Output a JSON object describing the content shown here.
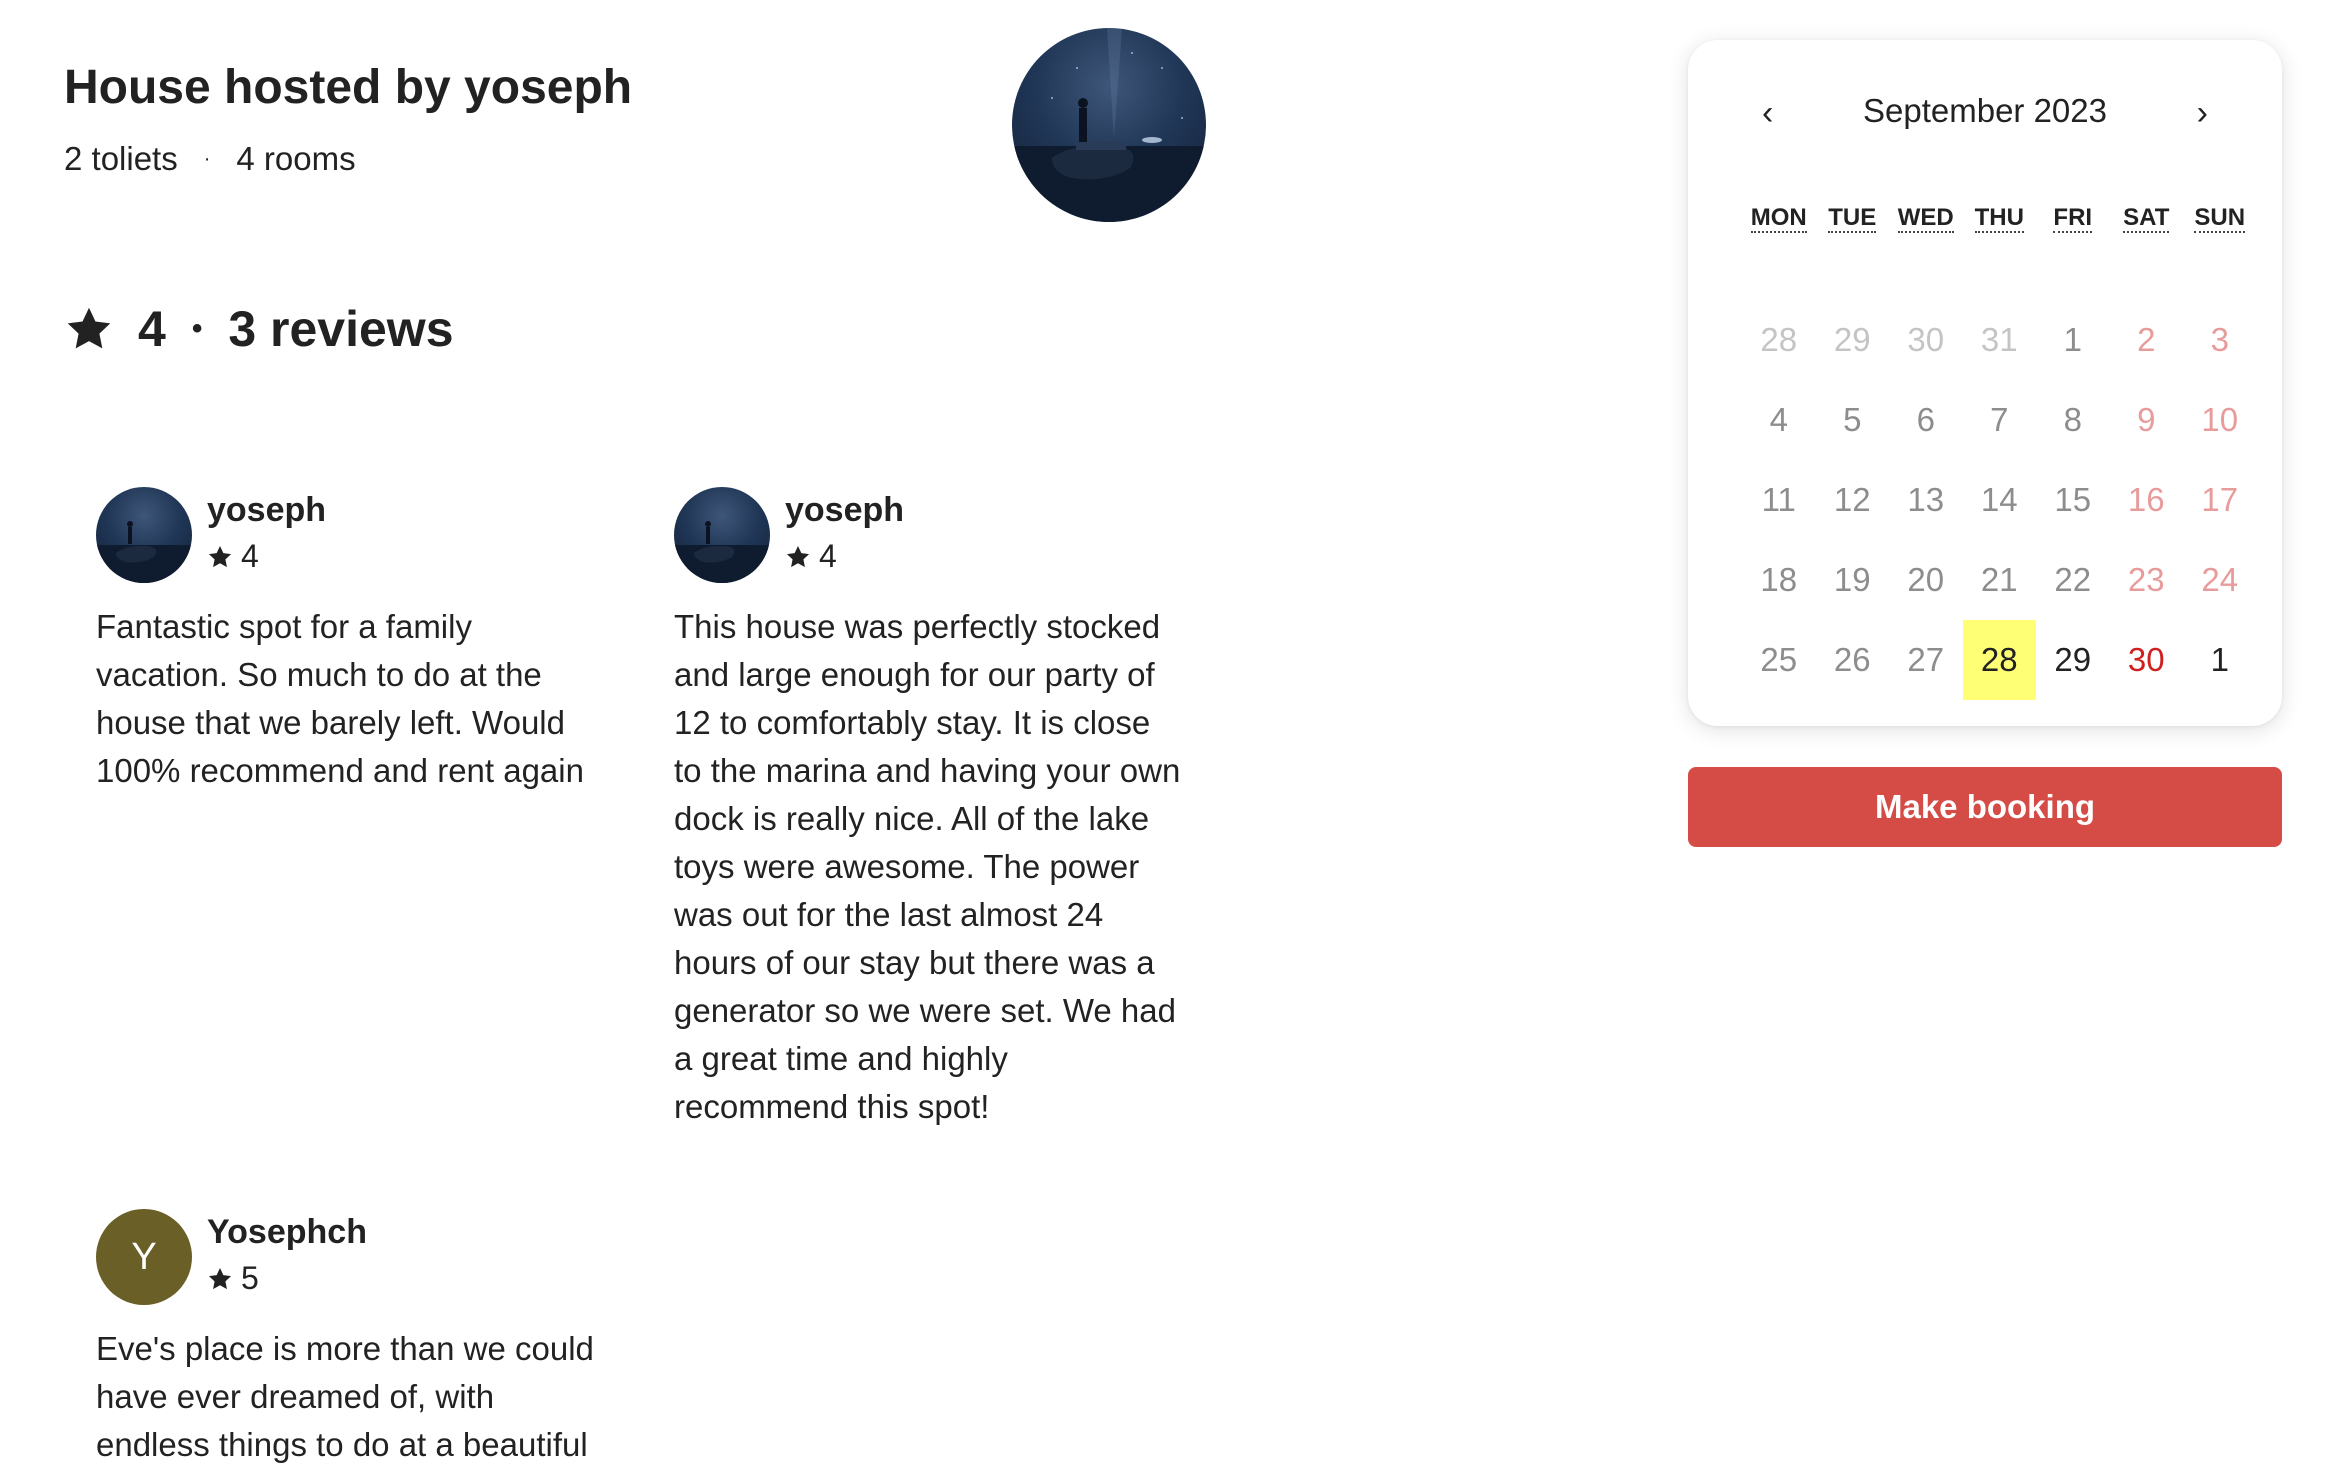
{
  "host": {
    "title": "House hosted by yoseph",
    "toilets": "2 toliets",
    "separator": "·",
    "rooms": "4 rooms"
  },
  "rating_summary": {
    "icon": "star-icon",
    "score": "4",
    "separator": "•",
    "reviews_count": "3 reviews"
  },
  "reviews": [
    {
      "name": "yoseph",
      "avatar": "photo",
      "rating": "4",
      "text": "Fantastic spot for a family vacation. So much to do at the house that we barely left. Would 100% recommend and rent again"
    },
    {
      "name": "yoseph",
      "avatar": "photo",
      "rating": "4",
      "text": "This house was perfectly stocked and large enough for our party of 12 to comfortably stay. It is close to the marina and having your own dock is really nice. All of the lake toys were awesome. The power was out for the last almost 24 hours of our stay but there was a generator so we were set. We had a great time and highly recommend this spot!"
    },
    {
      "name": "Yosephch",
      "avatar_letter": "Y",
      "rating": "5",
      "text": "Eve's place is more than we could have ever dreamed of, with endless things to do at a beautiful"
    }
  ],
  "calendar": {
    "title": "September 2023",
    "prev_label": "‹",
    "next_label": "›",
    "weekdays": [
      "MON",
      "TUE",
      "WED",
      "THU",
      "FRI",
      "SAT",
      "SUN"
    ],
    "weeks": [
      [
        "28",
        "29",
        "30",
        "31",
        "1",
        "2",
        "3"
      ],
      [
        "4",
        "5",
        "6",
        "7",
        "8",
        "9",
        "10"
      ],
      [
        "11",
        "12",
        "13",
        "14",
        "15",
        "16",
        "17"
      ],
      [
        "18",
        "19",
        "20",
        "21",
        "22",
        "23",
        "24"
      ],
      [
        "25",
        "26",
        "27",
        "28",
        "29",
        "30",
        "1"
      ]
    ],
    "highlighted_day": "28",
    "colors": {
      "highlight": "#ffff76",
      "weekend": "#e89b9b",
      "weekend_active": "#cf2020",
      "disabled": "#8d8d8d",
      "other_month": "#c4c4c4"
    }
  },
  "booking": {
    "button_label": "Make booking",
    "button_color": "#d54b45"
  }
}
